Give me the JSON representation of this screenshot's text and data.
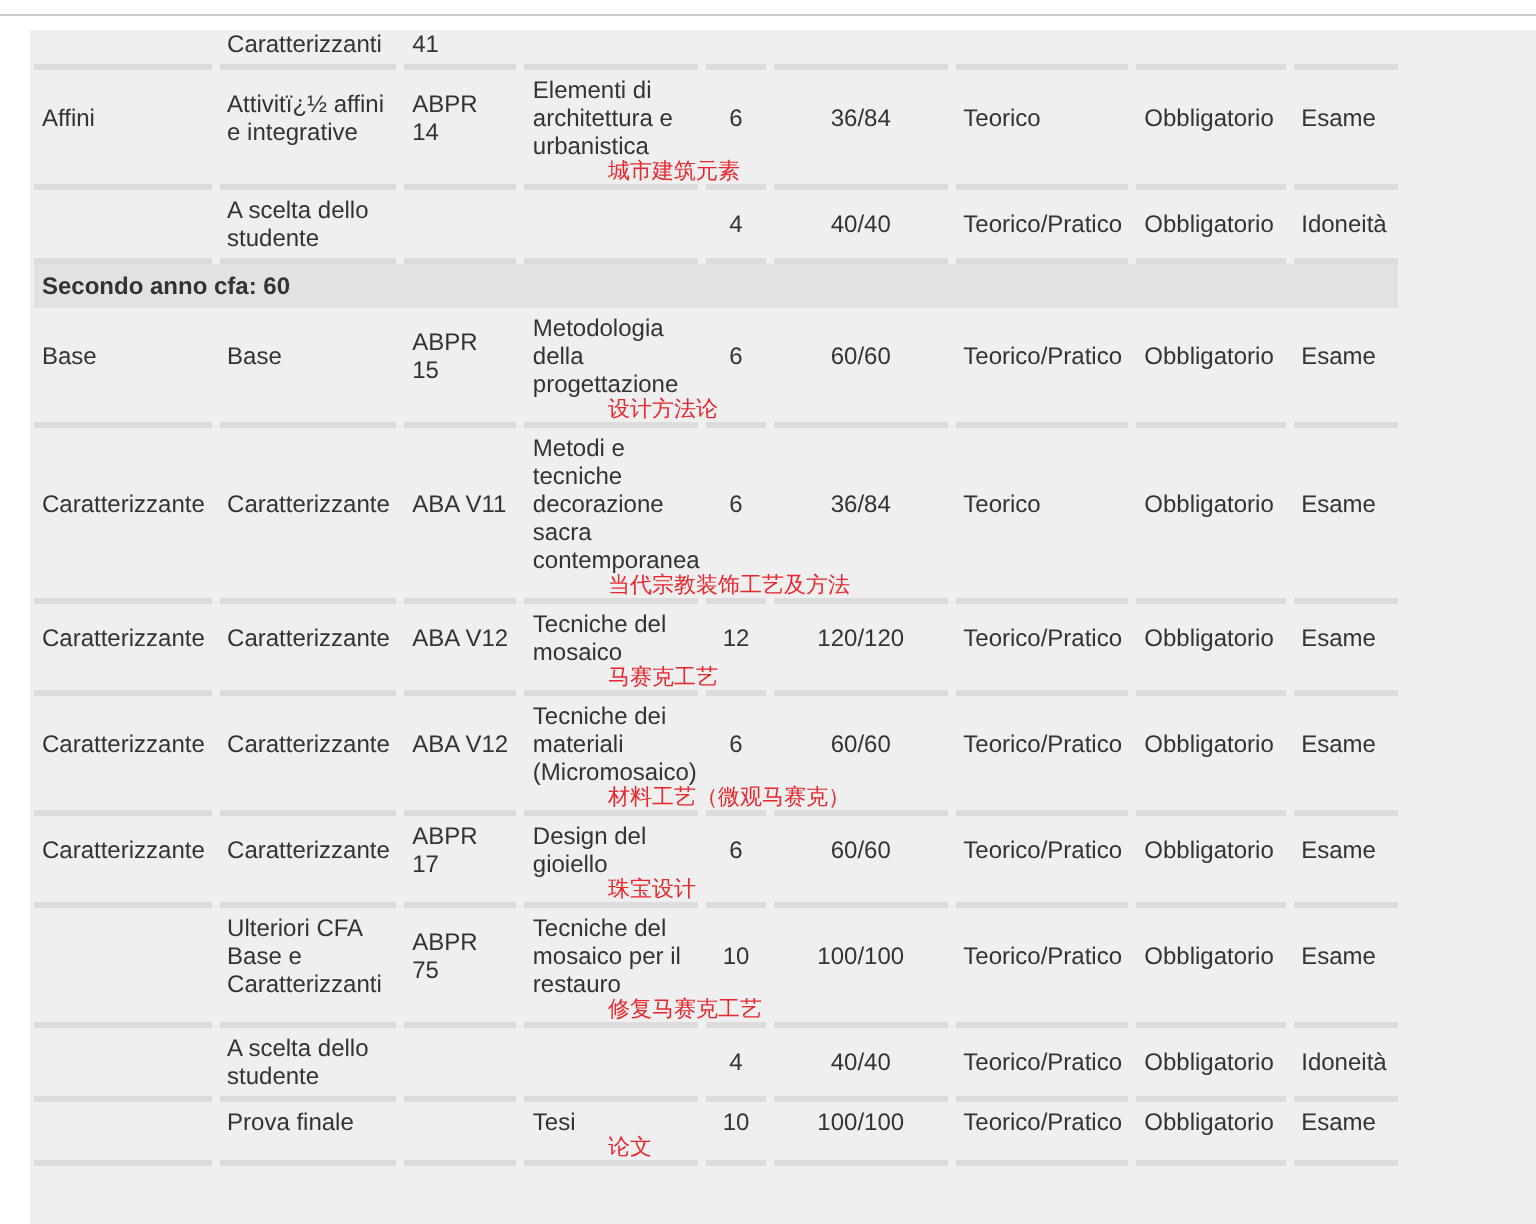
{
  "table": {
    "rows": [
      {
        "kind": "course",
        "column_2": "Caratterizzanti",
        "column_3": "41"
      },
      {
        "kind": "course",
        "column_1": "Affini",
        "column_2": "Attivitï¿½ affini e integrative",
        "column_3": "ABPR 14",
        "column_4": "Elementi di architettura e urbanistica",
        "note": "城市建筑元素",
        "column_5": "6",
        "column_6": "36/84",
        "column_7": "Teorico",
        "column_8": "Obbligatorio",
        "column_9": "Esame"
      },
      {
        "kind": "course",
        "column_2": "A scelta dello studente",
        "column_5": "4",
        "column_6": "40/40",
        "column_7": "Teorico/Pratico",
        "column_8": "Obbligatorio",
        "column_9": "Idoneità"
      },
      {
        "kind": "section",
        "title": "Secondo anno cfa: 60"
      },
      {
        "kind": "course",
        "column_1": "Base",
        "column_2": "Base",
        "column_3": "ABPR 15",
        "column_4": "Metodologia della progettazione",
        "note": "设计方法论",
        "column_5": "6",
        "column_6": "60/60",
        "column_7": "Teorico/Pratico",
        "column_8": "Obbligatorio",
        "column_9": "Esame"
      },
      {
        "kind": "course",
        "column_1": "Caratterizzante",
        "column_2": "Caratterizzante",
        "column_3": "ABA V11",
        "column_4": "Metodi e tecniche decorazione sacra contemporanea",
        "note": "当代宗教装饰工艺及方法",
        "column_5": "6",
        "column_6": "36/84",
        "column_7": "Teorico",
        "column_8": "Obbligatorio",
        "column_9": "Esame"
      },
      {
        "kind": "course",
        "column_1": "Caratterizzante",
        "column_2": "Caratterizzante",
        "column_3": "ABA V12",
        "column_4": "Tecniche del mosaico",
        "note": "马赛克工艺",
        "column_5": "12",
        "column_6": "120/120",
        "column_7": "Teorico/Pratico",
        "column_8": "Obbligatorio",
        "column_9": "Esame"
      },
      {
        "kind": "course",
        "column_1": "Caratterizzante",
        "column_2": "Caratterizzante",
        "column_3": "ABA V12",
        "column_4": "Tecniche dei materiali (Micromosaico)",
        "note": "材料工艺（微观马赛克）",
        "column_5": "6",
        "column_6": "60/60",
        "column_7": "Teorico/Pratico",
        "column_8": "Obbligatorio",
        "column_9": "Esame"
      },
      {
        "kind": "course",
        "column_1": "Caratterizzante",
        "column_2": "Caratterizzante",
        "column_3": "ABPR 17",
        "column_4": "Design del gioiello",
        "note": "珠宝设计",
        "column_5": "6",
        "column_6": "60/60",
        "column_7": "Teorico/Pratico",
        "column_8": "Obbligatorio",
        "column_9": "Esame"
      },
      {
        "kind": "course",
        "column_2": "Ulteriori CFA Base e Caratterizzanti",
        "column_3": "ABPR 75",
        "column_4": "Tecniche del mosaico per il restauro",
        "note": "修复马赛克工艺",
        "column_5": "10",
        "column_6": "100/100",
        "column_7": "Teorico/Pratico",
        "column_8": "Obbligatorio",
        "column_9": "Esame"
      },
      {
        "kind": "course",
        "column_2": "A scelta dello studente",
        "column_5": "4",
        "column_6": "40/40",
        "column_7": "Teorico/Pratico",
        "column_8": "Obbligatorio",
        "column_9": "Idoneità"
      },
      {
        "kind": "course",
        "column_2": "Prova finale",
        "column_4": "Tesi",
        "note": "论文",
        "column_5": "10",
        "column_6": "100/100",
        "column_7": "Teorico/Pratico",
        "column_8": "Obbligatorio",
        "column_9": "Esame"
      }
    ]
  }
}
